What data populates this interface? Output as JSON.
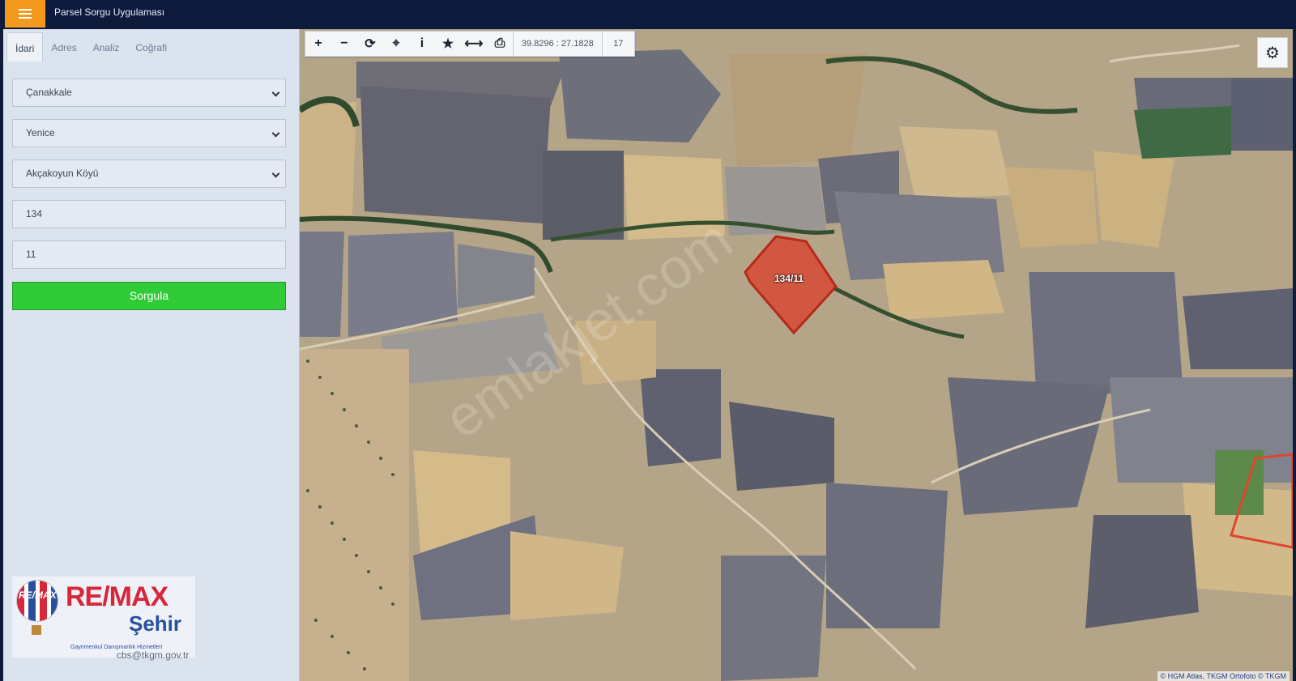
{
  "header": {
    "menu_icon": "hamburger-icon",
    "title": "Parsel Sorgu Uygulaması"
  },
  "sidebar": {
    "tabs": [
      {
        "label": "İdari",
        "active": true
      },
      {
        "label": "Adres",
        "active": false
      },
      {
        "label": "Analiz",
        "active": false
      },
      {
        "label": "Coğrafi",
        "active": false
      }
    ],
    "province": "Çanakkale",
    "district": "Yenice",
    "neighborhood": "Akçakoyun Köyü",
    "block_no": "134",
    "parcel_no": "11",
    "query_button": "Sorgula",
    "footer_email": "cbs@tkgm.gov.tr"
  },
  "logo": {
    "balloon_text": "RE/MAX",
    "brand": "RE/MAX",
    "sub": "Şehir",
    "tagline": "Gayrimenkul Danışmanlık Hizmetleri"
  },
  "map": {
    "coordinates": "39.8296 : 27.1828",
    "zoom": "17",
    "parcel_label": "134/11",
    "watermark": "emlakjet.com",
    "attribution": "© HGM Atlas, TKGM Ortofoto © TKGM",
    "parcel_color": "#d9432f",
    "toolbar_icons": [
      "zoom-in-icon",
      "zoom-out-icon",
      "refresh-icon",
      "locate-icon",
      "info-icon",
      "star-icon",
      "measure-icon",
      "print-icon"
    ],
    "settings_icon": "gear-icon"
  }
}
